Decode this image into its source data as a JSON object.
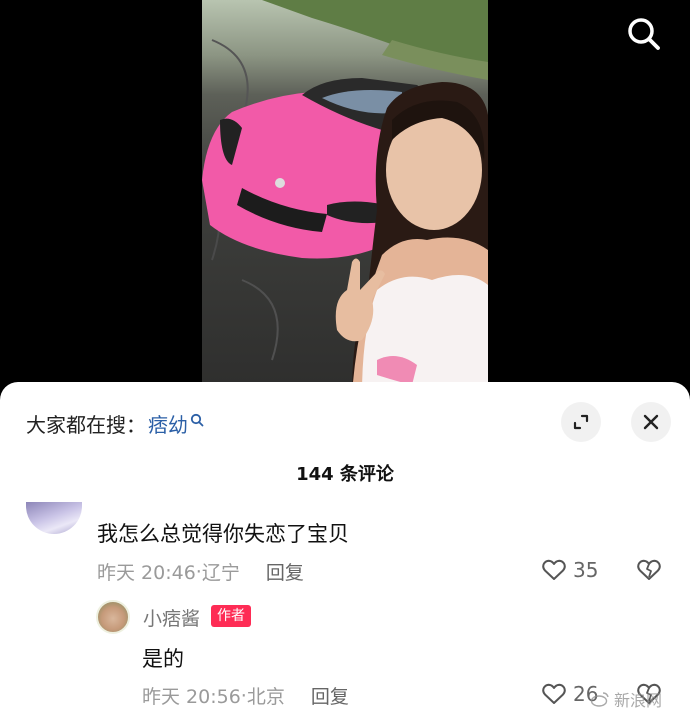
{
  "header": {
    "search_icon": "search-icon"
  },
  "sheet": {
    "search_prefix": "大家都在搜：",
    "search_keyword": "痞幼",
    "comment_count": "144 条评论",
    "expand_icon": "expand-icon",
    "close_icon": "close-icon"
  },
  "comments": [
    {
      "text": "我怎么总觉得你失恋了宝贝",
      "time": "昨天 20:46",
      "location": "辽宁",
      "reply_label": "回复",
      "likes": "35"
    }
  ],
  "reply": {
    "user": "小痞酱",
    "badge": "作者",
    "text": "是的",
    "time": "昨天 20:56",
    "location": "北京",
    "reply_label": "回复",
    "likes": "26"
  },
  "watermark": "新浪网"
}
